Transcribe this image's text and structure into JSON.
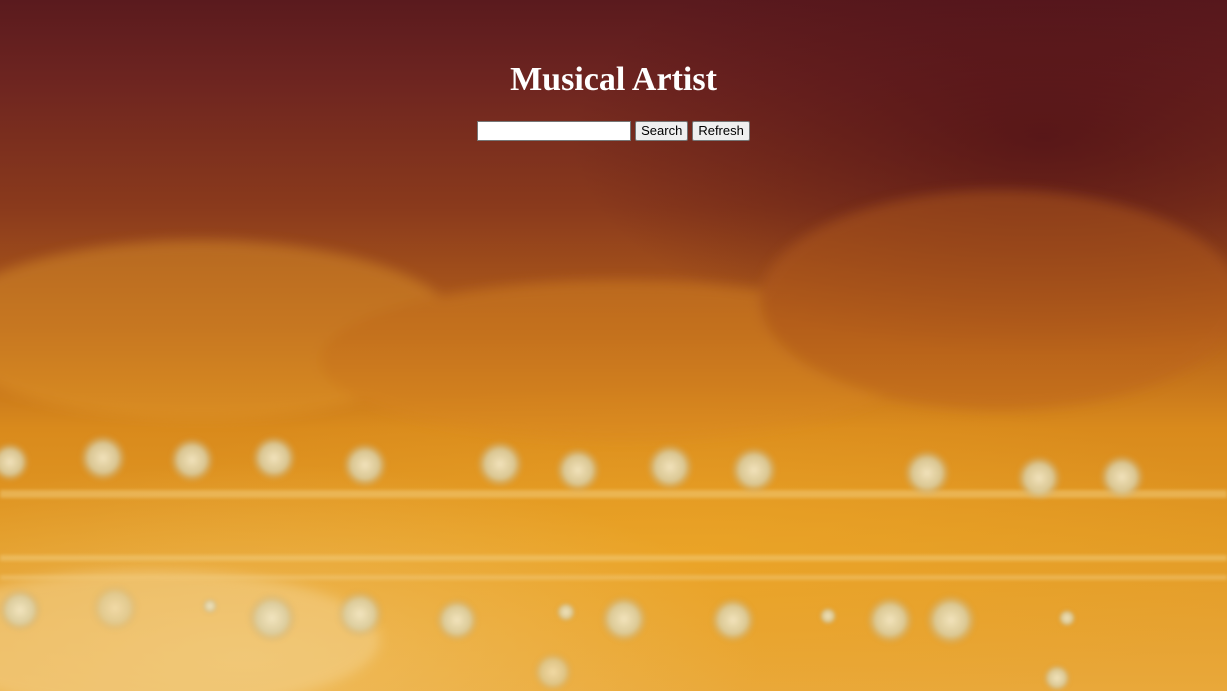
{
  "page": {
    "title": "Musical Artist"
  },
  "search": {
    "value": "",
    "placeholder": "",
    "search_label": "Search",
    "refresh_label": "Refresh"
  },
  "colors": {
    "title": "#ffffff",
    "background_top": "#5a1a1e",
    "background_bottom": "#e9a83a"
  },
  "background": {
    "description_icon": "concert-stage-lights-image"
  }
}
